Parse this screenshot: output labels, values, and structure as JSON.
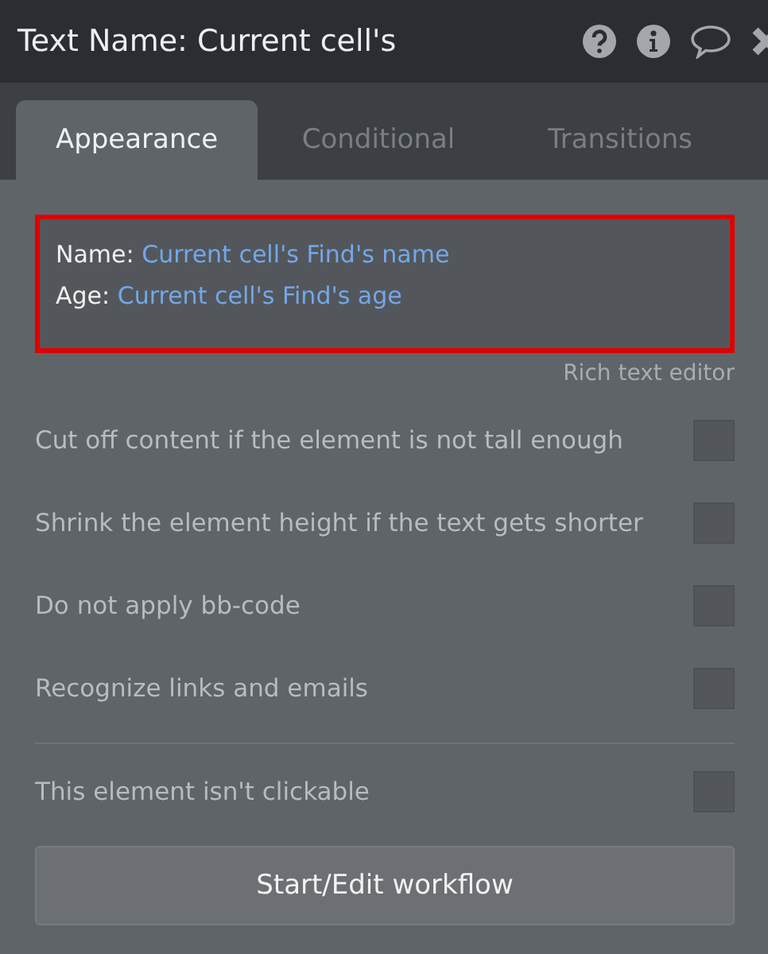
{
  "window": {
    "title": "Text Name: Current cell's"
  },
  "tabs": [
    {
      "label": "Appearance",
      "selected": true
    },
    {
      "label": "Conditional",
      "selected": false
    },
    {
      "label": "Transitions",
      "selected": false
    }
  ],
  "editor": {
    "lines": [
      {
        "label": "Name:",
        "value": "Current cell's Find's name"
      },
      {
        "label": "Age:",
        "value": "Current cell's Find's age"
      }
    ],
    "link": "Rich text editor"
  },
  "options": [
    {
      "label": "Cut off content if the element is not tall enough",
      "checked": false
    },
    {
      "label": "Shrink the element height if the text gets shorter",
      "checked": false
    },
    {
      "label": "Do not apply bb-code",
      "checked": false
    },
    {
      "label": "Recognize links and emails",
      "checked": false
    }
  ],
  "clickable": {
    "label": "This element isn't clickable",
    "checked": false
  },
  "button": "Start/Edit workflow"
}
